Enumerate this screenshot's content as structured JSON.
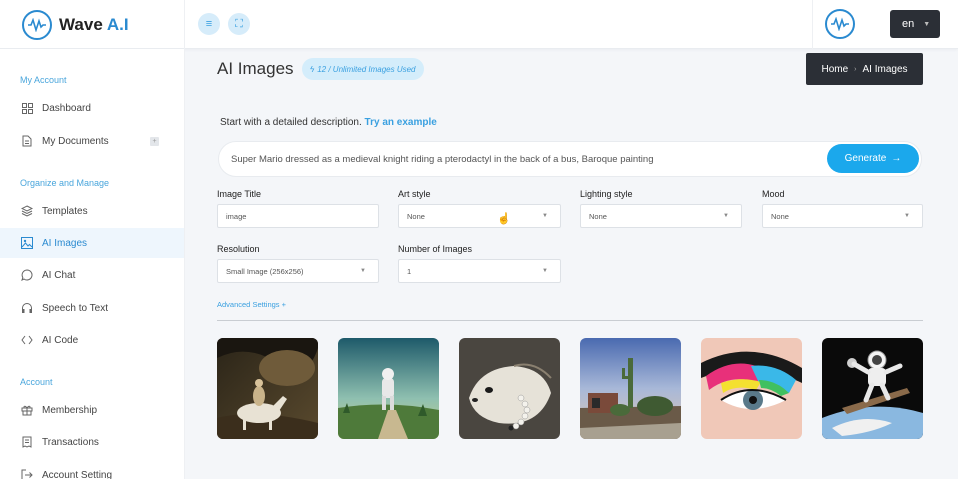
{
  "app": {
    "name_main": "Wave",
    "name_accent": "A.I"
  },
  "header": {
    "language": "en"
  },
  "sidebar": {
    "sections": [
      {
        "label": "My Account"
      },
      {
        "label": "Organize and Manage"
      },
      {
        "label": "Account"
      }
    ],
    "items": [
      {
        "label": "Dashboard",
        "icon": "grid-icon"
      },
      {
        "label": "My Documents",
        "icon": "document-icon"
      },
      {
        "label": "Templates",
        "icon": "layers-icon"
      },
      {
        "label": "AI Images",
        "icon": "image-icon",
        "active": true
      },
      {
        "label": "AI Chat",
        "icon": "chat-icon"
      },
      {
        "label": "Speech to Text",
        "icon": "headphones-icon"
      },
      {
        "label": "AI Code",
        "icon": "code-icon"
      },
      {
        "label": "Membership",
        "icon": "gift-icon"
      },
      {
        "label": "Transactions",
        "icon": "receipt-icon"
      },
      {
        "label": "Account Setting",
        "icon": "logout-icon"
      }
    ]
  },
  "main": {
    "title": "AI Images",
    "usage_badge": "12 / Unlimited Images Used",
    "breadcrumb": {
      "home": "Home",
      "current": "AI Images"
    },
    "prompt_label": "Start with a detailed description.",
    "try_example": "Try an example",
    "prompt_text": "Super Mario dressed as a medieval knight riding a pterodactyl in the back of a bus, Baroque painting",
    "generate_label": "Generate",
    "fields": {
      "image_title": {
        "label": "Image Title",
        "value": "image"
      },
      "art_style": {
        "label": "Art style",
        "value": "None"
      },
      "lighting_style": {
        "label": "Lighting style",
        "value": "None"
      },
      "mood": {
        "label": "Mood",
        "value": "None"
      },
      "resolution": {
        "label": "Resolution",
        "value": "Small Image (256x256)"
      },
      "number_of_images": {
        "label": "Number of Images",
        "value": "1"
      }
    },
    "advanced_settings": "Advanced Settings +"
  },
  "colors": {
    "accent": "#1ba8ec",
    "dark": "#2b2f36"
  }
}
